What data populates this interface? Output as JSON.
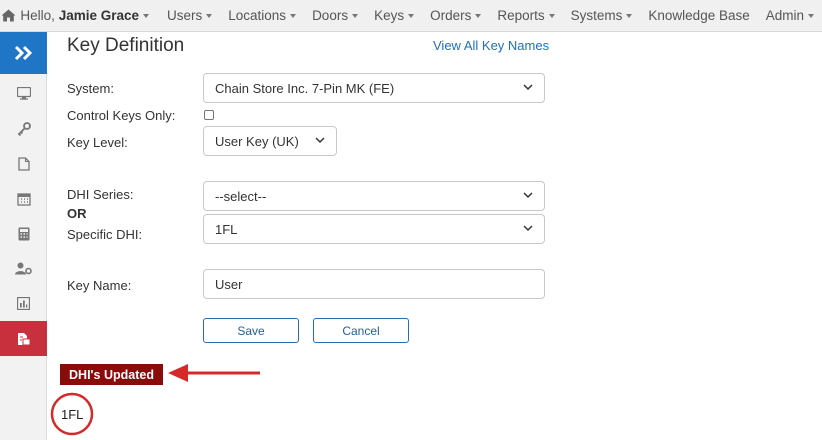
{
  "topnav": {
    "hello_prefix": "Hello,",
    "user_name": "Jamie Grace",
    "items": [
      {
        "label": "Users",
        "dropdown": true
      },
      {
        "label": "Locations",
        "dropdown": true
      },
      {
        "label": "Doors",
        "dropdown": true
      },
      {
        "label": "Keys",
        "dropdown": true
      },
      {
        "label": "Orders",
        "dropdown": true
      },
      {
        "label": "Reports",
        "dropdown": true
      },
      {
        "label": "Systems",
        "dropdown": true
      },
      {
        "label": "Knowledge Base",
        "dropdown": false
      },
      {
        "label": "Admin",
        "dropdown": true
      }
    ]
  },
  "sidebar": {
    "toggle_icon": "double-chevron-right-icon",
    "items": [
      {
        "icon": "monitor-icon"
      },
      {
        "icon": "key-icon"
      },
      {
        "icon": "document-icon"
      },
      {
        "icon": "calendar-icon"
      },
      {
        "icon": "calculator-icon"
      },
      {
        "icon": "user-gear-icon"
      },
      {
        "icon": "bar-chart-icon"
      },
      {
        "icon": "key-document-icon",
        "active": true
      }
    ],
    "active_color": "#c9303e",
    "toggle_color": "#1f76c6"
  },
  "form": {
    "title": "Key Definition",
    "view_all_link": "View All Key Names",
    "system_label": "System:",
    "system_value": "Chain Store Inc. 7-Pin MK (FE)",
    "control_keys_label": "Control Keys Only:",
    "control_keys_checked": false,
    "key_level_label": "Key Level:",
    "key_level_value": "User Key (UK)",
    "dhi_series_label": "DHI Series:",
    "dhi_series_value": "--select--",
    "or_label": "OR",
    "specific_dhi_label": "Specific DHI:",
    "specific_dhi_value": "1FL",
    "key_name_label": "Key Name:",
    "key_name_value": "User",
    "save_label": "Save",
    "cancel_label": "Cancel"
  },
  "result": {
    "badge_text": "DHI's Updated",
    "badge_color": "#8b0a0a",
    "updated_value": "1FL"
  },
  "annotation_color": "#d42a2a"
}
